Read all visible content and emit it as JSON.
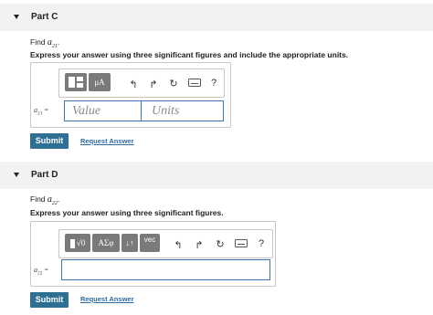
{
  "partC": {
    "title": "Part C",
    "find_prefix": "Find ",
    "var_symbol": "a",
    "var_sub": "21",
    "find_suffix": ".",
    "instruction": "Express your answer using three significant figures and include the appropriate units.",
    "toolbar": {
      "greek_label": "μA",
      "help_label": "?"
    },
    "label_eq": "=",
    "value_placeholder": "Value",
    "units_placeholder": "Units",
    "submit_label": "Submit",
    "request_label": "Request Answer"
  },
  "partD": {
    "title": "Part D",
    "find_prefix": "Find ",
    "var_symbol": "a",
    "var_sub": "22",
    "find_suffix": ".",
    "instruction": "Express your answer using three significant figures.",
    "toolbar": {
      "sqrt_label": "√0",
      "greek_label": "ΑΣφ",
      "arrows_label": "↓↑",
      "vec_label": "vec",
      "help_label": "?"
    },
    "label_eq": "=",
    "submit_label": "Submit",
    "request_label": "Request Answer"
  }
}
